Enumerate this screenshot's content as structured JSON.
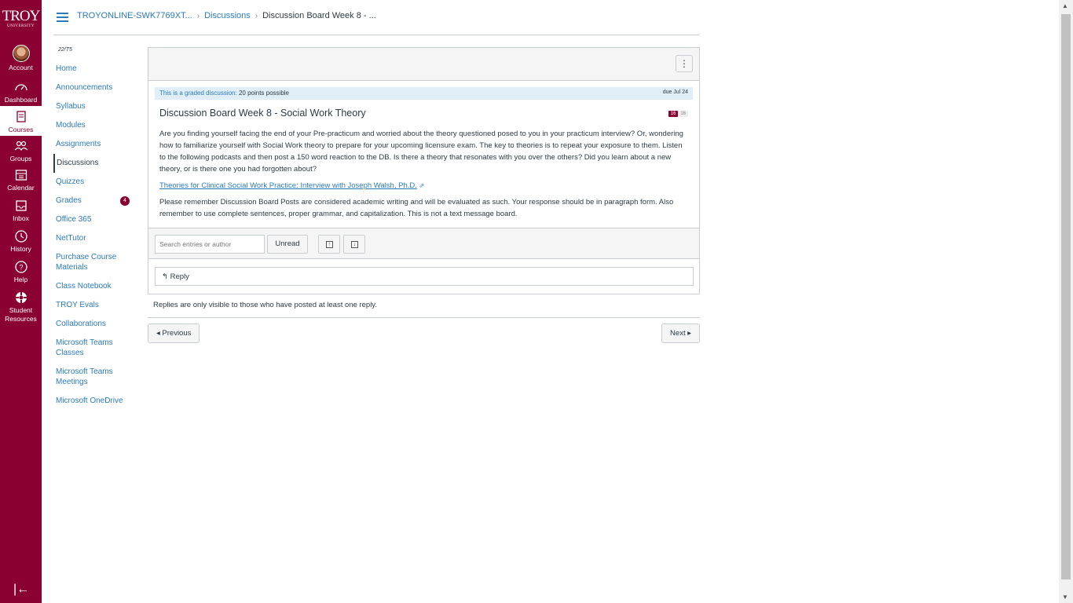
{
  "global_nav": {
    "logo_big": "TROY",
    "logo_small": "UNIVERSITY",
    "items": [
      {
        "label": "Account",
        "icon": "avatar"
      },
      {
        "label": "Dashboard",
        "icon": "dashboard-icon"
      },
      {
        "label": "Courses",
        "icon": "courses-icon"
      },
      {
        "label": "Groups",
        "icon": "groups-icon"
      },
      {
        "label": "Calendar",
        "icon": "calendar-icon"
      },
      {
        "label": "Inbox",
        "icon": "inbox-icon"
      },
      {
        "label": "History",
        "icon": "history-icon"
      },
      {
        "label": "Help",
        "icon": "help-icon"
      },
      {
        "label": "Student Resources",
        "icon": "student-resources-icon"
      }
    ],
    "collapse_glyph": "|←"
  },
  "header": {
    "breadcrumb": [
      "TROYONLINE-SWK7769XT...",
      "Discussions",
      "Discussion Board Week 8 - ..."
    ]
  },
  "course_nav": {
    "term": "22/T5",
    "items": [
      {
        "label": "Home"
      },
      {
        "label": "Announcements"
      },
      {
        "label": "Syllabus"
      },
      {
        "label": "Modules"
      },
      {
        "label": "Assignments"
      },
      {
        "label": "Discussions"
      },
      {
        "label": "Quizzes"
      },
      {
        "label": "Grades",
        "badge": "4"
      },
      {
        "label": "Office 365"
      },
      {
        "label": "NetTutor"
      },
      {
        "label": "Purchase Course Materials"
      },
      {
        "label": "Class Notebook"
      },
      {
        "label": "TROY Evals"
      },
      {
        "label": "Collaborations"
      },
      {
        "label": "Microsoft Teams Classes"
      },
      {
        "label": "Microsoft Teams Meetings"
      },
      {
        "label": "Microsoft OneDrive"
      }
    ]
  },
  "discussion": {
    "kebab": "⋮",
    "graded_label": "This is a graded discussion:",
    "points": "20 points possible",
    "due": "due Jul 24",
    "title": "Discussion Board Week 8 - Social Work Theory",
    "unread_count": "16",
    "total_count": "16",
    "paragraph1": "Are you finding yourself facing the end of your Pre-practicum and worried about the theory questioned posed to you in your practicum interview? Or, wondering how to familiarize yourself with Social Work theory to prepare for your upcoming licensure exam. The key to theories is to repeat your exposure to them. Listen to the following podcasts and then post a 150 word reaction to the DB. Is there a theory that resonates with you over the others? Did you learn about a new theory, or is there one you had forgotten about?",
    "link_text": "Theories for Clinical Social Work Practice: Interview with Joseph Walsh, Ph.D.",
    "paragraph2": "Please remember Discussion Board Posts are considered academic writing and will be evaluated as such. Your response should be in paragraph form.  Also remember to use complete sentences, proper grammar, and capitalization. This is not a text message board.",
    "search_placeholder": "Search entries or author",
    "unread_button": "Unread",
    "reply_label": "Reply",
    "notice": "Replies are only visible to those who have posted at least one reply.",
    "previous": "◂ Previous",
    "next": "Next ▸"
  }
}
